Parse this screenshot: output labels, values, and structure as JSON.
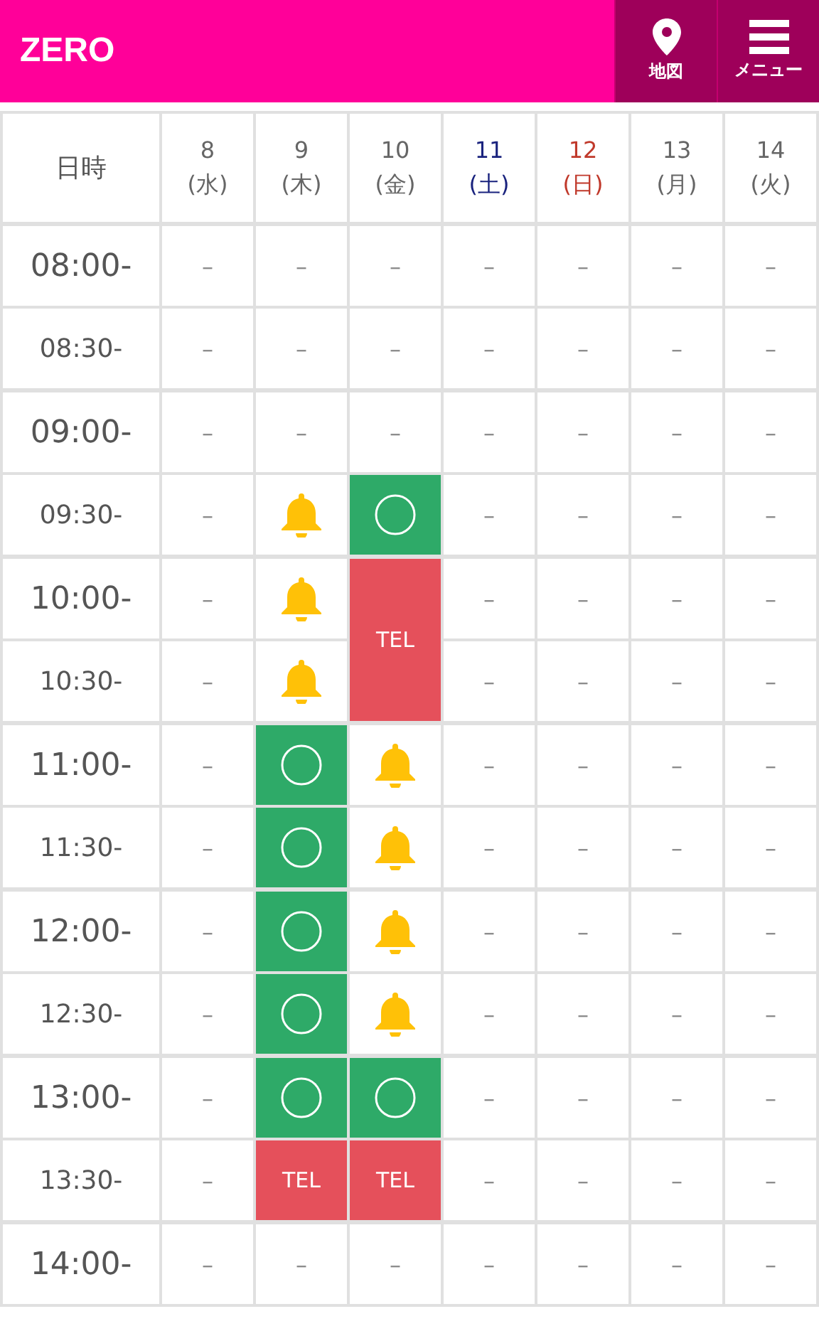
{
  "header": {
    "title": "ZERO",
    "buttons": [
      {
        "kind": "map",
        "label": "地図"
      },
      {
        "kind": "menu",
        "label": "メニュー"
      }
    ]
  },
  "table": {
    "corner": "日時",
    "days": [
      {
        "date": "8",
        "weekday": "(水)",
        "kind": "weekday"
      },
      {
        "date": "9",
        "weekday": "(木)",
        "kind": "weekday"
      },
      {
        "date": "10",
        "weekday": "(金)",
        "kind": "weekday"
      },
      {
        "date": "11",
        "weekday": "(土)",
        "kind": "saturday"
      },
      {
        "date": "12",
        "weekday": "(日)",
        "kind": "sunday"
      },
      {
        "date": "13",
        "weekday": "(月)",
        "kind": "weekday"
      },
      {
        "date": "14",
        "weekday": "(火)",
        "kind": "weekday"
      }
    ],
    "rows": [
      {
        "time": "08:00-",
        "hour": true,
        "cells": [
          {
            "kind": "none",
            "text": "–"
          },
          {
            "kind": "none",
            "text": "–"
          },
          {
            "kind": "none",
            "text": "–"
          },
          {
            "kind": "none",
            "text": "–"
          },
          {
            "kind": "none",
            "text": "–"
          },
          {
            "kind": "none",
            "text": "–"
          },
          {
            "kind": "none",
            "text": "–"
          }
        ]
      },
      {
        "time": "08:30-",
        "hour": false,
        "cells": [
          {
            "kind": "none",
            "text": "–"
          },
          {
            "kind": "none",
            "text": "–"
          },
          {
            "kind": "none",
            "text": "–"
          },
          {
            "kind": "none",
            "text": "–"
          },
          {
            "kind": "none",
            "text": "–"
          },
          {
            "kind": "none",
            "text": "–"
          },
          {
            "kind": "none",
            "text": "–"
          }
        ]
      },
      {
        "time": "09:00-",
        "hour": true,
        "cells": [
          {
            "kind": "none",
            "text": "–"
          },
          {
            "kind": "none",
            "text": "–"
          },
          {
            "kind": "none",
            "text": "–"
          },
          {
            "kind": "none",
            "text": "–"
          },
          {
            "kind": "none",
            "text": "–"
          },
          {
            "kind": "none",
            "text": "–"
          },
          {
            "kind": "none",
            "text": "–"
          }
        ]
      },
      {
        "time": "09:30-",
        "hour": false,
        "cells": [
          {
            "kind": "none",
            "text": "–"
          },
          {
            "kind": "bell"
          },
          {
            "kind": "open"
          },
          {
            "kind": "none",
            "text": "–"
          },
          {
            "kind": "none",
            "text": "–"
          },
          {
            "kind": "none",
            "text": "–"
          },
          {
            "kind": "none",
            "text": "–"
          }
        ]
      },
      {
        "time": "10:00-",
        "hour": true,
        "cells": [
          {
            "kind": "none",
            "text": "–"
          },
          {
            "kind": "bell"
          },
          {
            "kind": "tel",
            "text": "TEL",
            "rowspan": 2
          },
          {
            "kind": "none",
            "text": "–"
          },
          {
            "kind": "none",
            "text": "–"
          },
          {
            "kind": "none",
            "text": "–"
          },
          {
            "kind": "none",
            "text": "–"
          }
        ]
      },
      {
        "time": "10:30-",
        "hour": false,
        "cells": [
          {
            "kind": "none",
            "text": "–"
          },
          {
            "kind": "bell"
          },
          {
            "kind": "none",
            "text": "–"
          },
          {
            "kind": "none",
            "text": "–"
          },
          {
            "kind": "none",
            "text": "–"
          },
          {
            "kind": "none",
            "text": "–"
          }
        ]
      },
      {
        "time": "11:00-",
        "hour": true,
        "cells": [
          {
            "kind": "none",
            "text": "–"
          },
          {
            "kind": "open"
          },
          {
            "kind": "bell"
          },
          {
            "kind": "none",
            "text": "–"
          },
          {
            "kind": "none",
            "text": "–"
          },
          {
            "kind": "none",
            "text": "–"
          },
          {
            "kind": "none",
            "text": "–"
          }
        ]
      },
      {
        "time": "11:30-",
        "hour": false,
        "cells": [
          {
            "kind": "none",
            "text": "–"
          },
          {
            "kind": "open"
          },
          {
            "kind": "bell"
          },
          {
            "kind": "none",
            "text": "–"
          },
          {
            "kind": "none",
            "text": "–"
          },
          {
            "kind": "none",
            "text": "–"
          },
          {
            "kind": "none",
            "text": "–"
          }
        ]
      },
      {
        "time": "12:00-",
        "hour": true,
        "cells": [
          {
            "kind": "none",
            "text": "–"
          },
          {
            "kind": "open"
          },
          {
            "kind": "bell"
          },
          {
            "kind": "none",
            "text": "–"
          },
          {
            "kind": "none",
            "text": "–"
          },
          {
            "kind": "none",
            "text": "–"
          },
          {
            "kind": "none",
            "text": "–"
          }
        ]
      },
      {
        "time": "12:30-",
        "hour": false,
        "cells": [
          {
            "kind": "none",
            "text": "–"
          },
          {
            "kind": "open"
          },
          {
            "kind": "bell"
          },
          {
            "kind": "none",
            "text": "–"
          },
          {
            "kind": "none",
            "text": "–"
          },
          {
            "kind": "none",
            "text": "–"
          },
          {
            "kind": "none",
            "text": "–"
          }
        ]
      },
      {
        "time": "13:00-",
        "hour": true,
        "cells": [
          {
            "kind": "none",
            "text": "–"
          },
          {
            "kind": "open"
          },
          {
            "kind": "open"
          },
          {
            "kind": "none",
            "text": "–"
          },
          {
            "kind": "none",
            "text": "–"
          },
          {
            "kind": "none",
            "text": "–"
          },
          {
            "kind": "none",
            "text": "–"
          }
        ]
      },
      {
        "time": "13:30-",
        "hour": false,
        "cells": [
          {
            "kind": "none",
            "text": "–"
          },
          {
            "kind": "tel",
            "text": "TEL"
          },
          {
            "kind": "tel",
            "text": "TEL"
          },
          {
            "kind": "none",
            "text": "–"
          },
          {
            "kind": "none",
            "text": "–"
          },
          {
            "kind": "none",
            "text": "–"
          },
          {
            "kind": "none",
            "text": "–"
          }
        ]
      },
      {
        "time": "14:00-",
        "hour": true,
        "cells": [
          {
            "kind": "none",
            "text": "–"
          },
          {
            "kind": "none",
            "text": "–"
          },
          {
            "kind": "none",
            "text": "–"
          },
          {
            "kind": "none",
            "text": "–"
          },
          {
            "kind": "none",
            "text": "–"
          },
          {
            "kind": "none",
            "text": "–"
          },
          {
            "kind": "none",
            "text": "–"
          }
        ]
      }
    ]
  }
}
